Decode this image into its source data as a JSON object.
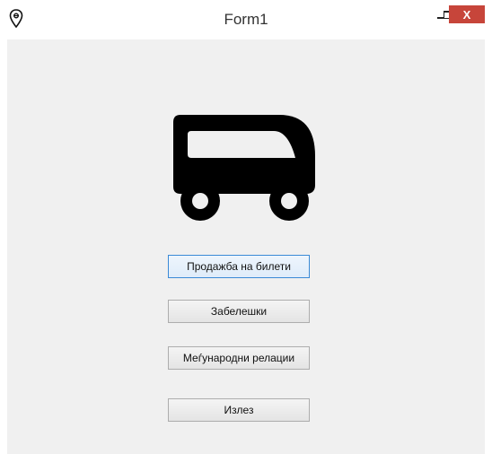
{
  "window": {
    "title": "Form1",
    "icon": "map-pin-icon",
    "controls": {
      "minimize_icon": "minimize-icon",
      "maximize_icon": "maximize-icon",
      "close_label": "X"
    }
  },
  "main": {
    "image_icon": "bus-icon",
    "buttons": [
      {
        "label": "Продажба на билети",
        "focused": true
      },
      {
        "label": "Забелешки"
      },
      {
        "label": "Меѓународни релации"
      },
      {
        "label": "Излез"
      }
    ]
  },
  "colors": {
    "close_button": "#c7453a",
    "client_background": "#f0f0f0",
    "focus_border": "#3a8ad6"
  }
}
